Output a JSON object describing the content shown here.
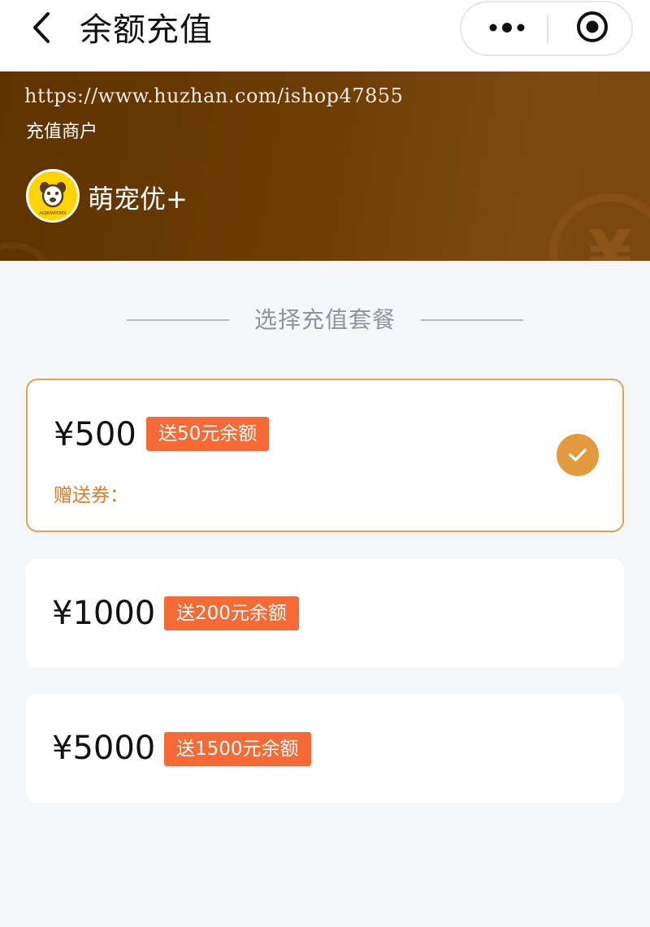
{
  "nav": {
    "title": "余额充值",
    "back_icon": "chevron-left-icon",
    "more_icon": "more-dots-icon",
    "close_icon": "target-circle-icon"
  },
  "banner": {
    "watermark": "https://www.huzhan.com/ishop47855",
    "merchant_label": "充值商户",
    "merchant_name": "萌宠优+",
    "logo_icon": "pet-logo-icon",
    "logo_text": "AIQBIWPOMX",
    "coin_symbol": "¥"
  },
  "section": {
    "title": "选择充值套餐"
  },
  "packages": [
    {
      "price": "¥500",
      "bonus": "送50元余额",
      "gift_label": "赠送券：",
      "selected": true
    },
    {
      "price": "¥1000",
      "bonus": "送200元余额",
      "selected": false
    },
    {
      "price": "¥5000",
      "bonus": "送1500元余额",
      "selected": false
    }
  ],
  "colors": {
    "accent": "#e39a3c",
    "bonus_badge": "#f76a35",
    "banner_dark": "#5e3300",
    "page_bg": "#f5f6f8"
  }
}
